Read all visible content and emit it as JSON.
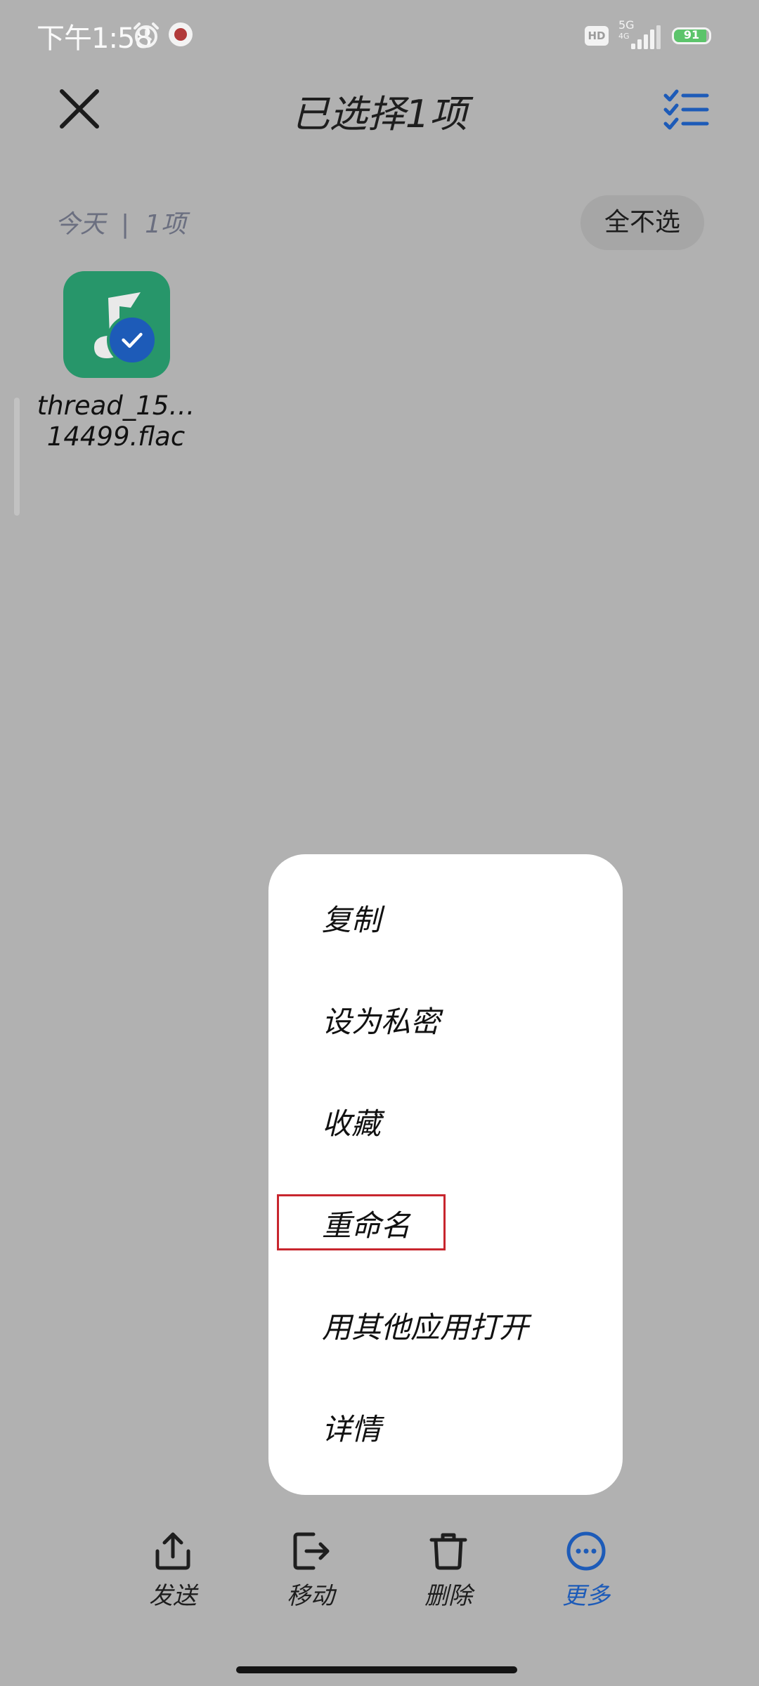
{
  "status_bar": {
    "time": "下午1:58",
    "hd": "HD",
    "network": "5G",
    "network_sub": "4G",
    "battery": "91",
    "battery_level": 0.91,
    "icons": [
      "alarm-icon",
      "recording-icon",
      "signal-icon",
      "battery-icon"
    ]
  },
  "header": {
    "title": "已选择1项",
    "close_icon": "close-icon",
    "checklist_icon": "checklist-icon",
    "accent_color": "#1d5bb8"
  },
  "group": {
    "date": "今天",
    "count": "1项",
    "deselect_label": "全不选"
  },
  "file": {
    "name_line1": "thread_15…",
    "name_line2": "14499.flac",
    "icon": "music-note-icon",
    "selected": true,
    "thumb_color": "#27966a"
  },
  "menu": {
    "items": [
      {
        "label": "复制"
      },
      {
        "label": "设为私密"
      },
      {
        "label": "收藏"
      },
      {
        "label": "重命名"
      },
      {
        "label": "用其他应用打开"
      },
      {
        "label": "详情"
      }
    ],
    "highlighted_item": "重命名",
    "highlight_color": "#c8262e"
  },
  "toolbar": {
    "items": [
      {
        "label": "发送",
        "icon": "share-icon"
      },
      {
        "label": "移动",
        "icon": "move-icon"
      },
      {
        "label": "删除",
        "icon": "trash-icon"
      },
      {
        "label": "更多",
        "icon": "more-icon",
        "active": true
      }
    ]
  }
}
